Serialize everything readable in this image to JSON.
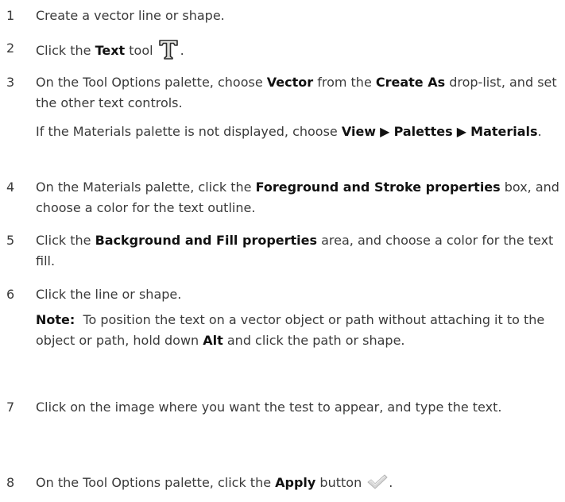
{
  "steps": [
    {
      "num": "1",
      "line": [
        "Create a vector line or shape."
      ]
    },
    {
      "num": "2",
      "pre": "Click the ",
      "b1": "Text",
      "post": " tool",
      "icon": "text-tool-icon",
      "after": "."
    },
    {
      "num": "3",
      "pre": "On the Tool Options palette, choose ",
      "b1": "Vector",
      "mid": " from the ",
      "b2": "Create As",
      "post": " drop-list, and set the other text controls.",
      "extra": {
        "pre": "If the Materials palette is not displayed, choose ",
        "b1": "View",
        "b2": "Palettes",
        "b3": "Materials",
        "post": ".",
        "sep": " ▶ "
      }
    },
    {
      "num": "4",
      "pre": "On the Materials palette, click the ",
      "b1": "Foreground and Stroke properties",
      "post": " box, and choose a color for the text outline."
    },
    {
      "num": "5",
      "pre": "Click the ",
      "b1": "Background and Fill properties",
      "post": " area, and choose a color for the text fill."
    },
    {
      "num": "6",
      "line": [
        "Click the line or shape."
      ],
      "note": {
        "label": "Note:",
        "pre": "  To position the text on a vector object or path without attaching it to the object or path, hold down ",
        "b1": "Alt",
        "post": " and click the path or shape."
      }
    },
    {
      "num": "7",
      "line": [
        "Click on the image where you want the test to appear, and type the text."
      ]
    },
    {
      "num": "8",
      "pre": "On the Tool Options palette, click the ",
      "b1": "Apply",
      "post": " button",
      "icon": "checkmark-icon",
      "after": "."
    }
  ]
}
